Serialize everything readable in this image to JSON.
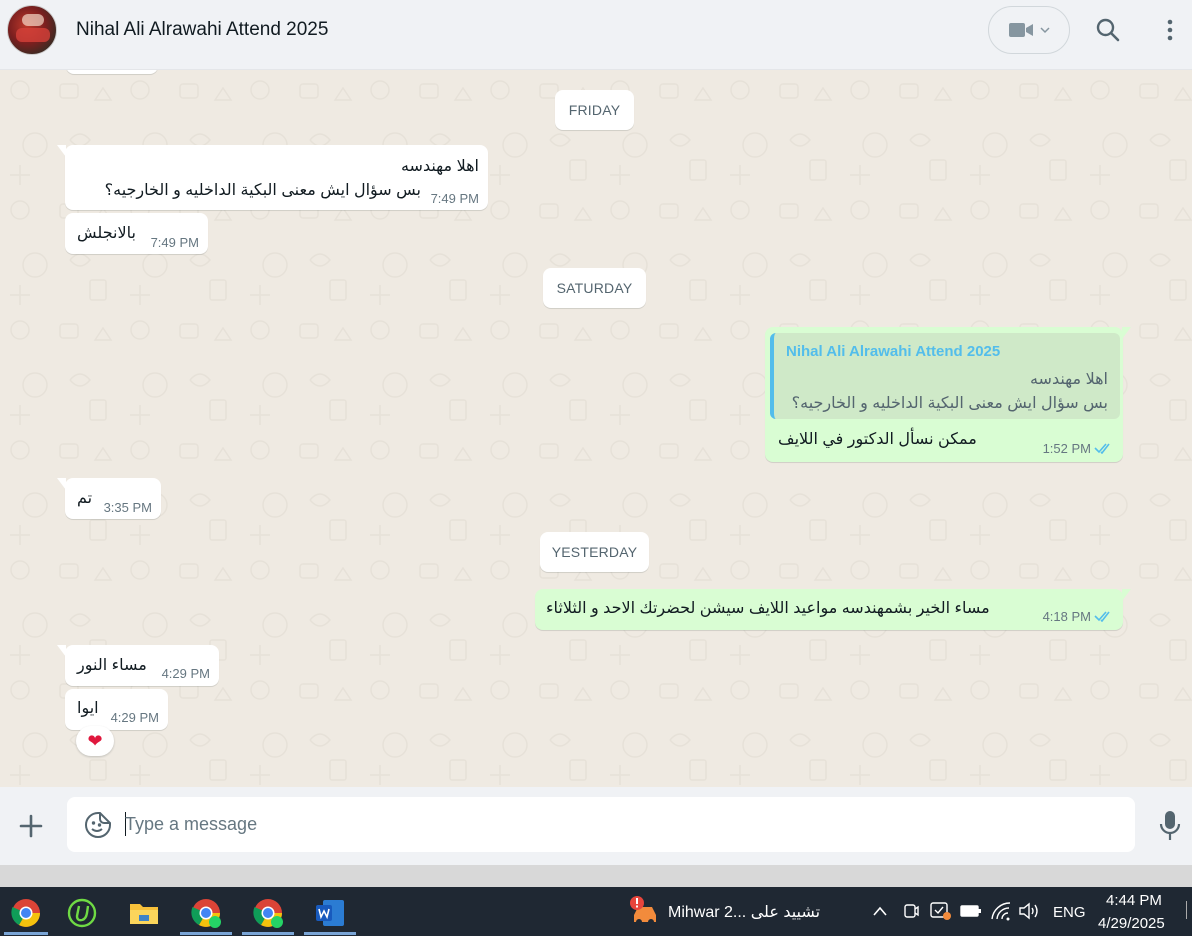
{
  "header": {
    "title": "Nihal Ali Alrawahi Attend 2025"
  },
  "dates": {
    "friday": "FRIDAY",
    "saturday": "SATURDAY",
    "yesterday": "YESTERDAY"
  },
  "messages": [
    {
      "dir": "in",
      "lines": [
        "اهلا مهندسه",
        "بس سؤال ايش معنى البكية الداخليه و الخارجيه؟"
      ],
      "time": "7:49 PM"
    },
    {
      "dir": "in",
      "lines": [
        "بالانجلش"
      ],
      "time": "7:49 PM"
    },
    {
      "dir": "out",
      "quote_name": "Nihal Ali Alrawahi Attend 2025",
      "quote_lines": [
        "اهلا مهندسه",
        "بس سؤال ايش معنى البكية الداخليه و الخارجيه؟"
      ],
      "lines": [
        "ممكن نسأل الدكتور في اللايف"
      ],
      "time": "1:52 PM"
    },
    {
      "dir": "in",
      "lines": [
        "تم"
      ],
      "time": "3:35 PM"
    },
    {
      "dir": "out",
      "lines": [
        "مساء الخير بشمهندسه مواعيد اللايف سيشن  لحضرتك الاحد و الثلاثاء"
      ],
      "time": "4:18 PM"
    },
    {
      "dir": "in",
      "lines": [
        "مساء النور"
      ],
      "time": "4:29 PM"
    },
    {
      "dir": "in",
      "lines": [
        "ايوا"
      ],
      "time": "4:29 PM",
      "reaction": "❤"
    }
  ],
  "composer": {
    "placeholder": "Type a message"
  },
  "taskbar": {
    "notification_text": "Mihwar 2... تشييد على",
    "language": "ENG",
    "time": "4:44 PM",
    "date": "4/29/2025"
  },
  "colors": {
    "incoming_bubble": "#ffffff",
    "outgoing_bubble": "#d9fdd3",
    "chat_background": "#efeae2",
    "header_background": "#f0f2f5",
    "read_ticks": "#53bdeb",
    "taskbar": "#1f2833"
  }
}
